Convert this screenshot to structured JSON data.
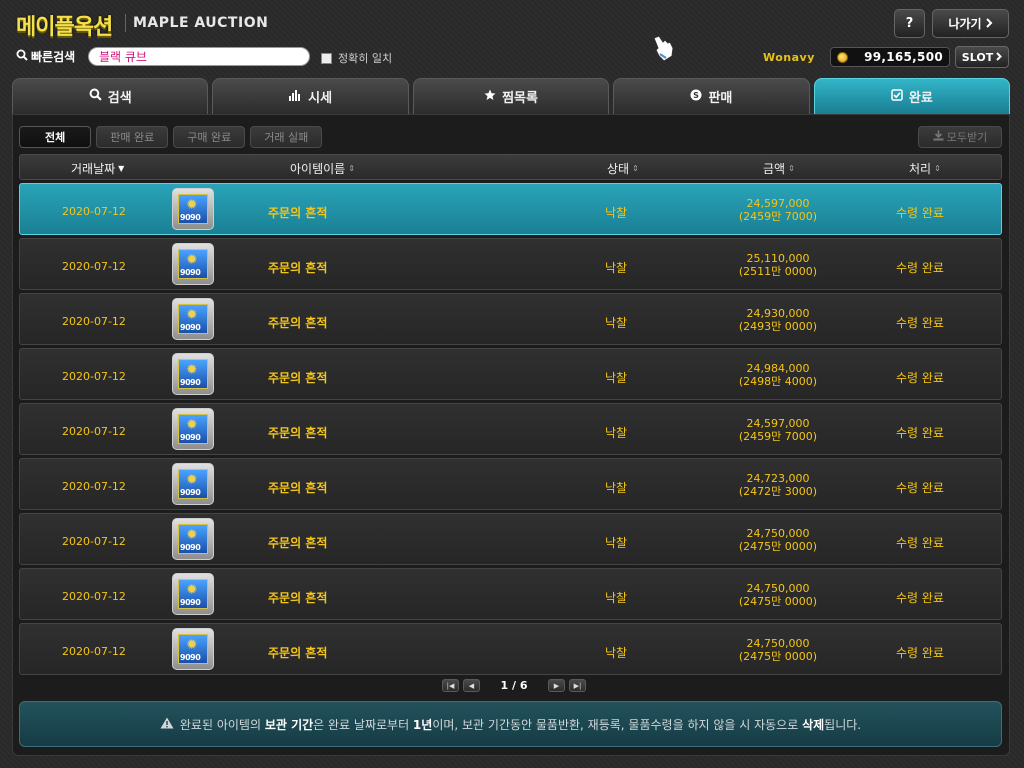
{
  "header": {
    "logo_ko": "메이플옥션",
    "logo_en": "MAPLE AUCTION",
    "quick_search_label": "빠른검색",
    "quick_search_value": "블랙 큐브",
    "exact_match_label": "정확히 일치",
    "help_label": "?",
    "exit_label": "나가기",
    "username": "Wonavy",
    "meso": "99,165,500",
    "slot_label": "SLOT"
  },
  "tabs": [
    {
      "label": "검색",
      "icon": "search-icon"
    },
    {
      "label": "시세",
      "icon": "chart-icon"
    },
    {
      "label": "찜목록",
      "icon": "star-icon"
    },
    {
      "label": "판매",
      "icon": "coin-s-icon"
    },
    {
      "label": "완료",
      "icon": "check-box-icon",
      "active": true
    }
  ],
  "filters": [
    "전체",
    "판매 완료",
    "구매 완료",
    "거래 실패"
  ],
  "receive_all_label": "모두받기",
  "columns": {
    "date": "거래날짜",
    "name": "아이템이름",
    "state": "상태",
    "price": "금액",
    "process": "처리"
  },
  "rows": [
    {
      "date": "2020-07-12",
      "icon_num": "9090",
      "name": "주문의 흔적",
      "state": "낙찰",
      "price": "24,597,000",
      "price_ko": "(2459만 7000)",
      "process": "수령 완료"
    },
    {
      "date": "2020-07-12",
      "icon_num": "9090",
      "name": "주문의 흔적",
      "state": "낙찰",
      "price": "25,110,000",
      "price_ko": "(2511만 0000)",
      "process": "수령 완료"
    },
    {
      "date": "2020-07-12",
      "icon_num": "9090",
      "name": "주문의 흔적",
      "state": "낙찰",
      "price": "24,930,000",
      "price_ko": "(2493만 0000)",
      "process": "수령 완료"
    },
    {
      "date": "2020-07-12",
      "icon_num": "9090",
      "name": "주문의 흔적",
      "state": "낙찰",
      "price": "24,984,000",
      "price_ko": "(2498만 4000)",
      "process": "수령 완료"
    },
    {
      "date": "2020-07-12",
      "icon_num": "9090",
      "name": "주문의 흔적",
      "state": "낙찰",
      "price": "24,597,000",
      "price_ko": "(2459만 7000)",
      "process": "수령 완료"
    },
    {
      "date": "2020-07-12",
      "icon_num": "9090",
      "name": "주문의 흔적",
      "state": "낙찰",
      "price": "24,723,000",
      "price_ko": "(2472만 3000)",
      "process": "수령 완료"
    },
    {
      "date": "2020-07-12",
      "icon_num": "9090",
      "name": "주문의 흔적",
      "state": "낙찰",
      "price": "24,750,000",
      "price_ko": "(2475만 0000)",
      "process": "수령 완료"
    },
    {
      "date": "2020-07-12",
      "icon_num": "9090",
      "name": "주문의 흔적",
      "state": "낙찰",
      "price": "24,750,000",
      "price_ko": "(2475만 0000)",
      "process": "수령 완료"
    },
    {
      "date": "2020-07-12",
      "icon_num": "9090",
      "name": "주문의 흔적",
      "state": "낙찰",
      "price": "24,750,000",
      "price_ko": "(2475만 0000)",
      "process": "수령 완료"
    }
  ],
  "pagination": {
    "text": "1 / 6"
  },
  "notice": {
    "p1": "완료된 아이템의 ",
    "b1": "보관 기간",
    "p2": "은 완료 날짜로부터 ",
    "b2": "1년",
    "p3": "이며, 보관 기간동안 물품반환, 재등록, 물품수령을 하지 않을 시 자동으로 ",
    "b3": "삭제",
    "p4": "됩니다."
  },
  "colors": {
    "accent": "#1fa0b5",
    "gold": "#f5c518"
  }
}
